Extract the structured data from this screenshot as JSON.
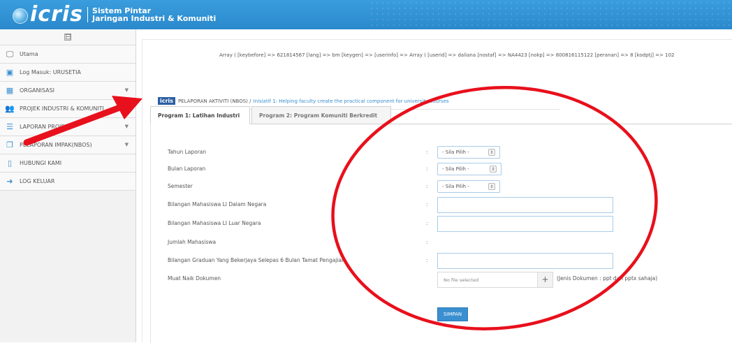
{
  "header": {
    "logo_text": "icris",
    "subtitle_line1": "Sistem Pintar",
    "subtitle_line2": "Jaringan Industri & Komuniti"
  },
  "sidebar": {
    "collapse_symbol": "⊟",
    "items": [
      {
        "label": "Utama",
        "icon": "monitor-icon",
        "has_submenu": false
      },
      {
        "label": "Log Masuk: URUSETIA",
        "icon": "id-card-icon",
        "has_submenu": false
      },
      {
        "label": "ORGANISASI",
        "icon": "building-icon",
        "has_submenu": true
      },
      {
        "label": "PROJEK INDUSTRI & KOMUNITI",
        "icon": "users-icon",
        "has_submenu": false
      },
      {
        "label": "LAPORAN PROJEK",
        "icon": "list-icon",
        "has_submenu": true
      },
      {
        "label": "PELAPORAN IMPAK(NBOS)",
        "icon": "copy-icon",
        "has_submenu": true
      },
      {
        "label": "HUBUNGI KAMI",
        "icon": "phone-icon",
        "has_submenu": false
      },
      {
        "label": "LOG KELUAR",
        "icon": "logout-icon",
        "has_submenu": false
      }
    ]
  },
  "main": {
    "debug_text": "Array ( [keybefore] => 621814567 [lang] => bm [keygen] => [userinfo] => Array ( [userid] => daliana [nostaf] => NA4423 [nokp] => 800816115122 [peranan] => 8 [kodptj] => 102",
    "breadcrumb": {
      "badge": "icris",
      "section": "PELAPORAN AKTIVITI (NBOS) /",
      "link": "Inisiatif 1: Helping faculty create the practical component for university courses"
    },
    "tabs": [
      {
        "label": "Program 1: Latihan Industri",
        "active": true
      },
      {
        "label": "Program 2: Program Komuniti Berkredit",
        "active": false
      }
    ],
    "form": {
      "colon": ":",
      "fields": [
        {
          "label": "Tahun Laporan",
          "type": "select",
          "value": "- Sila Pilih -"
        },
        {
          "label": "Bulan Laporan",
          "type": "select",
          "value": "- Sila Pilih -"
        },
        {
          "label": "Semester",
          "type": "select",
          "value": "- Sila Pilih -"
        },
        {
          "label": "Bilangan Mahasiswa LI Dalam Negara",
          "type": "text",
          "value": ""
        },
        {
          "label": "Bilangan Mahasiswa LI Luar Negara",
          "type": "text",
          "value": ""
        },
        {
          "label": "Jumlah Mahasiswa",
          "type": "readonly",
          "value": ""
        },
        {
          "label": "Bilangan Graduan Yang Bekerjaya Selepas 6 Bulan Tamat Pengajian",
          "type": "text",
          "value": ""
        },
        {
          "label": "Muat Naik Dokumen",
          "type": "file",
          "value": "No file selected"
        }
      ],
      "file_note": "(Jenis Dokumen : ppt dan pptx sahaja)",
      "select_arrow": "⇕",
      "file_plus": "+",
      "submit_label": "SIMPAN"
    }
  },
  "colors": {
    "header": "#2d8fd0",
    "accent": "#3a8fd0",
    "annotation": "#e8101c"
  }
}
